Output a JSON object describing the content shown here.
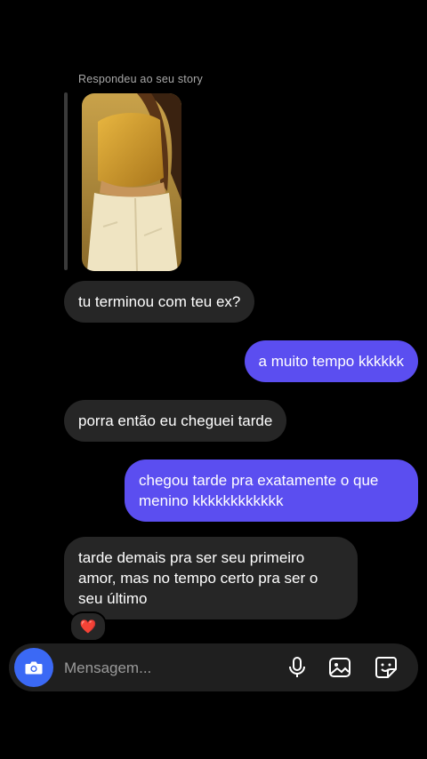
{
  "story": {
    "label": "Respondeu ao seu story"
  },
  "messages": [
    {
      "side": "in",
      "text": "tu terminou com teu ex?"
    },
    {
      "side": "out",
      "text": "a muito tempo kkkkkk"
    },
    {
      "side": "in",
      "text": "porra então eu cheguei tarde"
    },
    {
      "side": "out",
      "text": "chegou tarde pra exatamente o que menino kkkkkkkkkkkk"
    },
    {
      "side": "in",
      "text": "tarde demais pra ser seu primeiro amor, mas no tempo certo pra ser o seu último"
    }
  ],
  "reaction": {
    "emoji": "❤️"
  },
  "composer": {
    "placeholder": "Mensagem...",
    "icons": [
      "camera-icon",
      "microphone-icon",
      "gallery-icon",
      "sticker-icon"
    ]
  },
  "colors": {
    "background": "#000000",
    "incoming_bubble": "#262626",
    "outgoing_bubble": "#5b4ef0",
    "camera_button": "#3b69f5"
  }
}
